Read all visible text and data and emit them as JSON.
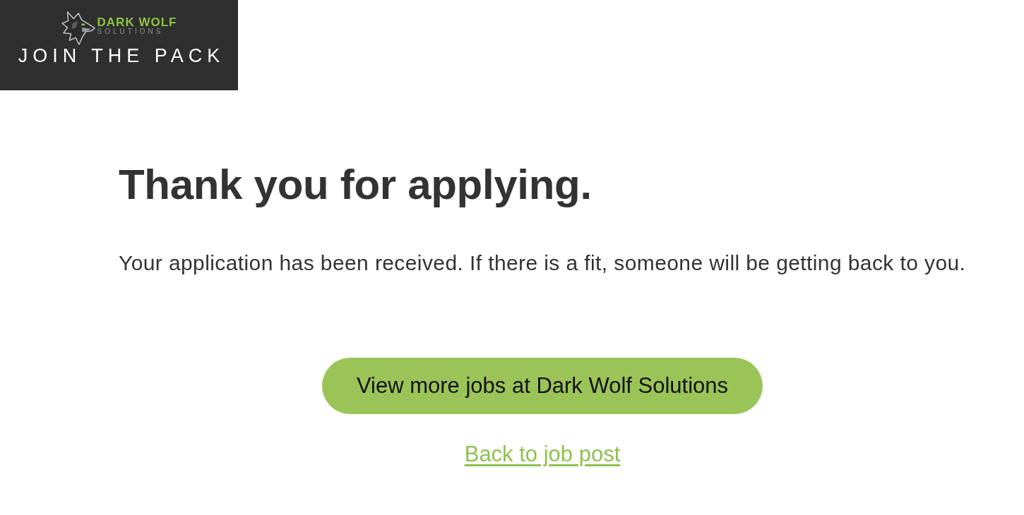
{
  "logo": {
    "brand_name": "DARK WOLF",
    "brand_subtitle": "SOLUTIONS",
    "tagline": "JOIN THE PACK"
  },
  "heading": "Thank you for applying.",
  "message": "Your application has been received. If there is a fit, someone will be getting back to you.",
  "actions": [
    {
      "kind": "button",
      "label": "View more jobs at Dark Wolf Solutions"
    },
    {
      "kind": "link",
      "label": "Back to job post"
    }
  ]
}
